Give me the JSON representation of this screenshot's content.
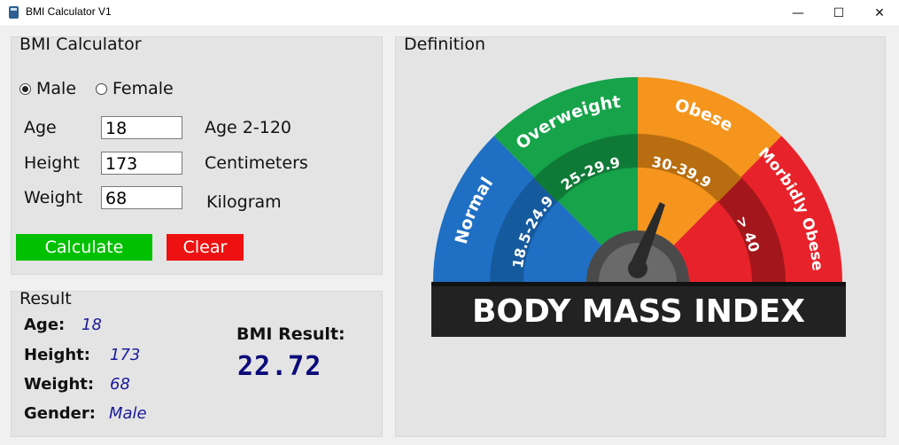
{
  "window": {
    "title": "BMI Calculator V1",
    "minimize_glyph": "—",
    "maximize_glyph": "☐",
    "close_glyph": "✕"
  },
  "calculator": {
    "title": "BMI Calculator",
    "gender_options": [
      "Male",
      "Female"
    ],
    "selected_gender": "Male",
    "age": {
      "label": "Age",
      "value": "18",
      "hint": "Age 2-120"
    },
    "height": {
      "label": "Height",
      "value": "173",
      "hint": "Centimeters"
    },
    "weight": {
      "label": "Weight",
      "value": "68",
      "hint": "Kilogram"
    },
    "calculate_label": "Calculate",
    "clear_label": "Clear",
    "colors": {
      "calculate": "#00c000",
      "clear": "#ee1111"
    }
  },
  "result": {
    "title": "Result",
    "age_label": "Age:",
    "age_value": "18",
    "height_label": "Height:",
    "height_value": "173",
    "weight_label": "Weight:",
    "weight_value": "68",
    "gender_label": "Gender:",
    "gender_value": "Male",
    "bmi_label": "BMI Result:",
    "bmi_value": "22.72"
  },
  "definition": {
    "title": "Definition",
    "banner": "BODY MASS INDEX",
    "categories": [
      {
        "name": "Normal",
        "range": "18.5-24.9",
        "color": "#1f6fc4"
      },
      {
        "name": "Overweight",
        "range": "25-29.9",
        "color": "#16a34a"
      },
      {
        "name": "Obese",
        "range": "30-39.9",
        "color": "#f5951d"
      },
      {
        "name": "Morbidly Obese",
        "range": "> 40",
        "color": "#e8222a"
      }
    ]
  }
}
